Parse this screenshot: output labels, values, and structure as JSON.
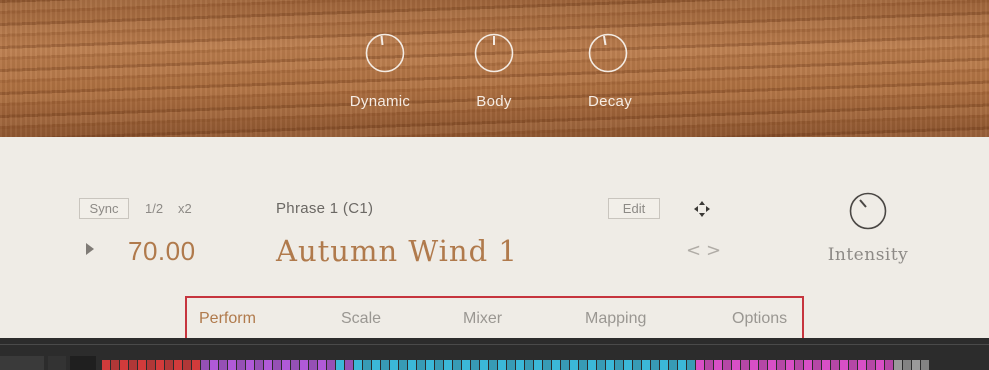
{
  "header": {
    "knobs": [
      {
        "label": "Dynamic",
        "icon": "knob-icon"
      },
      {
        "label": "Body",
        "icon": "knob-icon"
      },
      {
        "label": "Decay",
        "icon": "knob-icon"
      }
    ]
  },
  "controls": {
    "sync_label": "Sync",
    "half_label": "1/2",
    "double_label": "x2",
    "tempo": "70.00",
    "phrase_title": "Phrase 1 (C1)",
    "phrase_name": "Autumn Wind 1",
    "edit_label": "Edit",
    "prev_label": "<",
    "next_label": ">",
    "intensity_label": "Intensity"
  },
  "tabs": [
    {
      "label": "Perform",
      "active": true
    },
    {
      "label": "Scale",
      "active": false
    },
    {
      "label": "Mixer",
      "active": false
    },
    {
      "label": "Mapping",
      "active": false
    },
    {
      "label": "Options",
      "active": false
    }
  ],
  "colors": {
    "accent": "#b07a4c",
    "highlight_box": "#c6353e",
    "key_red": "#d23b3b",
    "key_purple": "#b05ad8",
    "key_cyan": "#3bb8d8",
    "key_magenta": "#d84fc6"
  }
}
